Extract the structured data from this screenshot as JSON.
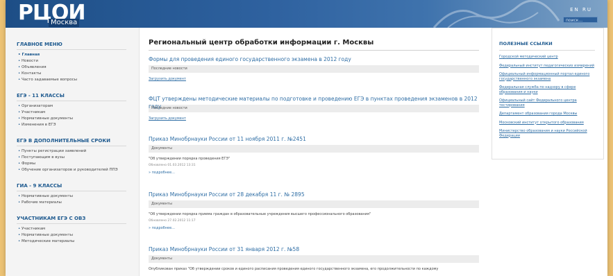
{
  "header": {
    "logo": "РЦОИ",
    "logo_sub": "Москва",
    "lang": "EN RU",
    "search_placeholder": "поиск..."
  },
  "sidebar": {
    "sections": [
      {
        "title": "Главное меню",
        "items": [
          "Главная",
          "Новости",
          "Объявления",
          "Контакты",
          "Часто задаваемые вопросы"
        ]
      },
      {
        "title": "ЕГЭ - 11 классы",
        "items": [
          "Организаторам",
          "Участникам",
          "Нормативные документы",
          "Изменения в ЕГЭ"
        ]
      },
      {
        "title": "ЕГЭ в дополнительные сроки",
        "items": [
          "Пункты регистрации заявлений",
          "Поступающим в вузы",
          "Формы",
          "Обучение организаторов и руководителей ППЭ"
        ]
      },
      {
        "title": "ГИА - 9 классы",
        "items": [
          "Нормативные документы",
          "Рабочие материалы"
        ]
      },
      {
        "title": "Участникам ЕГЭ с ОВЗ",
        "items": [
          "Участникам",
          "Нормативные документы",
          "Методические материалы"
        ]
      }
    ]
  },
  "main": {
    "title": "Региональный центр обработки информации г. Москвы",
    "articles": [
      {
        "title": "Формы для проведения единого государственного экзамена в 2012 году",
        "category": "Последние новости",
        "link": "Загрузить документ"
      },
      {
        "title": "ФЦТ утверждены методические материалы по подготовке и проведению ЕГЭ в пунктах проведения экзаменов в 2012 году",
        "category": "Последние новости",
        "link": "Загрузить документ"
      },
      {
        "title": "Приказ Минобрнауки России от 11 ноября 2011 г. №2451",
        "category": "Документы",
        "text": "\"Об утверждении порядка проведения ЕГЭ\"",
        "date": "Обновлено 01.03.2012 13:31",
        "more": "подробнее..."
      },
      {
        "title": "Приказ Минобрнауки России от 28 декабря 11 г. № 2895",
        "category": "Документы",
        "text": "\"Об утверждении порядка приема граждан в образовательные учреждения высшего профессионального образования\"",
        "date": "Обновлено 27.02.2012 11:17",
        "more": "подробнее..."
      },
      {
        "title": "Приказ Минобрнауки России от 31 января 2012 г. №58",
        "category": "Документы",
        "text": "Опубликован приказ \"Об утверждении сроков и единого расписания проведения единого государственного экзамена, его продолжительности по каждому"
      }
    ]
  },
  "useful_links": {
    "title": "Полезные ссылки",
    "items": [
      "Городской методический центр",
      "Федеральный институт педагогических измерений",
      "Официальный информационный портал единого государственного экзамена",
      "Федеральная служба по надзору в сфере образования и науки",
      "Официальный сайт Федерального центра тестирования",
      "Департамент образования города Москвы",
      "Московский институт открытого образования",
      "Министерство образования и науки Российской Федерации"
    ]
  }
}
